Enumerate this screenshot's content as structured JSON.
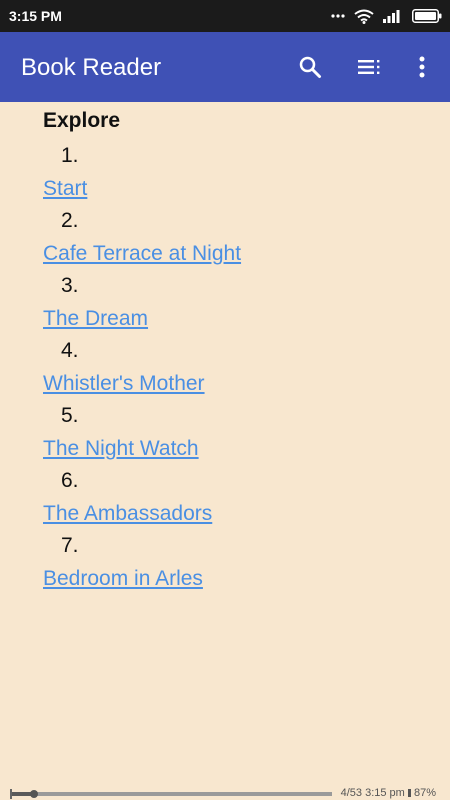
{
  "status_bar": {
    "time": "3:15 PM",
    "icons": [
      "signal-dots-icon",
      "wifi-icon",
      "cellular-signal-icon",
      "battery-icon"
    ]
  },
  "app_bar": {
    "title": "Book Reader",
    "actions": [
      "search-icon",
      "table-of-contents-icon",
      "more-vert-icon"
    ],
    "color": "#3f51b5"
  },
  "toc": {
    "heading": "Explore",
    "items": [
      {
        "number": "1.",
        "title": "Start"
      },
      {
        "number": "2.",
        "title": "Cafe Terrace at Night"
      },
      {
        "number": "3.",
        "title": "The Dream"
      },
      {
        "number": "4.",
        "title": "Whistler's Mother"
      },
      {
        "number": "5.",
        "title": "The Night Watch"
      },
      {
        "number": "6.",
        "title": "The Ambassadors"
      },
      {
        "number": "7.",
        "title": "Bedroom in Arles"
      }
    ]
  },
  "footer": {
    "page": "4/53",
    "time": "3:15 pm",
    "battery": "87%",
    "progress_fraction": 0.075
  },
  "colors": {
    "page_background": "#f8e7cf",
    "link": "#4a8fe3",
    "status_bar": "#1b1b1b"
  }
}
